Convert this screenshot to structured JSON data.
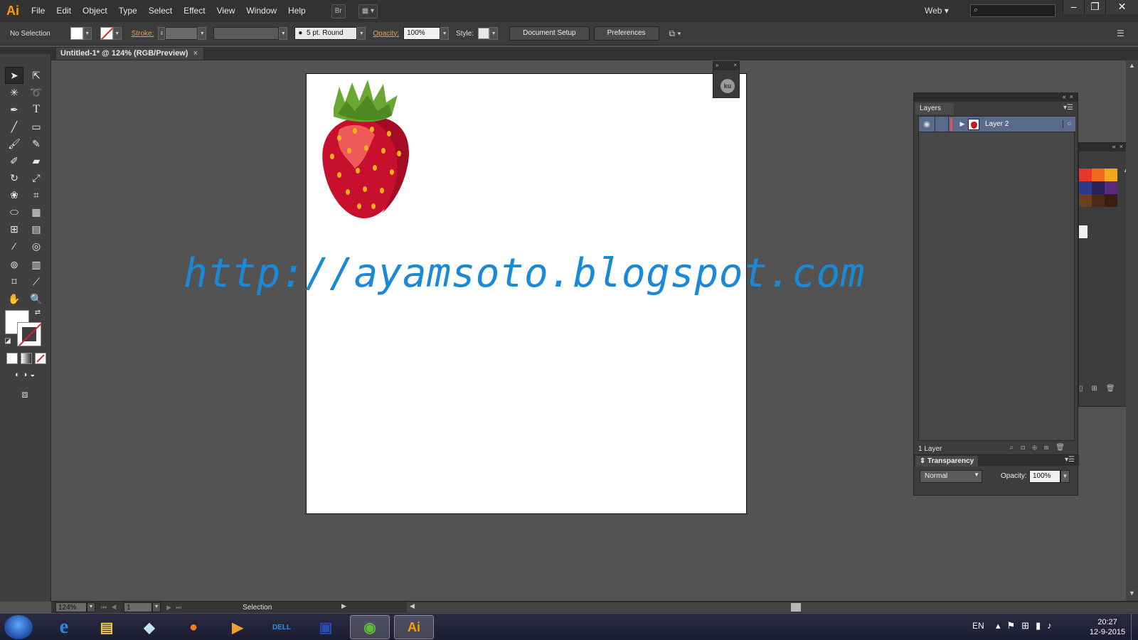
{
  "app": {
    "logo": "Ai",
    "menu": [
      "File",
      "Edit",
      "Object",
      "Type",
      "Select",
      "Effect",
      "View",
      "Window",
      "Help"
    ],
    "bridge_label": "Br",
    "workspace": "Web"
  },
  "control_bar": {
    "selection": "No Selection",
    "stroke_label": "Stroke:",
    "brush": "5 pt. Round",
    "opacity_label": "Opacity:",
    "opacity_value": "100%",
    "style_label": "Style:",
    "document_setup": "Document Setup",
    "preferences": "Preferences"
  },
  "document": {
    "tab_title": "Untitled-1* @ 124% (RGB/Preview)",
    "watermark": "http://ayamsoto.blogspot.com"
  },
  "mini_panel": {
    "badge": "ku"
  },
  "layers_panel": {
    "tab": "Layers",
    "layers": [
      {
        "name": "Layer 2",
        "color": "#e84f4f"
      }
    ],
    "count": "1 Layer"
  },
  "transparency_panel": {
    "tab": "Transparency",
    "blend_mode": "Normal",
    "opacity_label": "Opacity:",
    "opacity_value": "100%"
  },
  "swatches": [
    "#e8352a",
    "#f06a22",
    "#f7a51e",
    "#2b3a8c",
    "#2a2056",
    "#5a2a82",
    "#6a4020",
    "#4a2a18",
    "#3a1e14"
  ],
  "status_bar": {
    "zoom": "124%",
    "artboard": "1",
    "tool": "Selection"
  },
  "taskbar": {
    "language": "EN",
    "time": "20:27",
    "date": "12-9-2015",
    "apps": [
      "internet-explorer",
      "file-explorer",
      "notepad",
      "firefox",
      "media-player",
      "dell",
      "save-disk",
      "evernote",
      "illustrator"
    ]
  }
}
